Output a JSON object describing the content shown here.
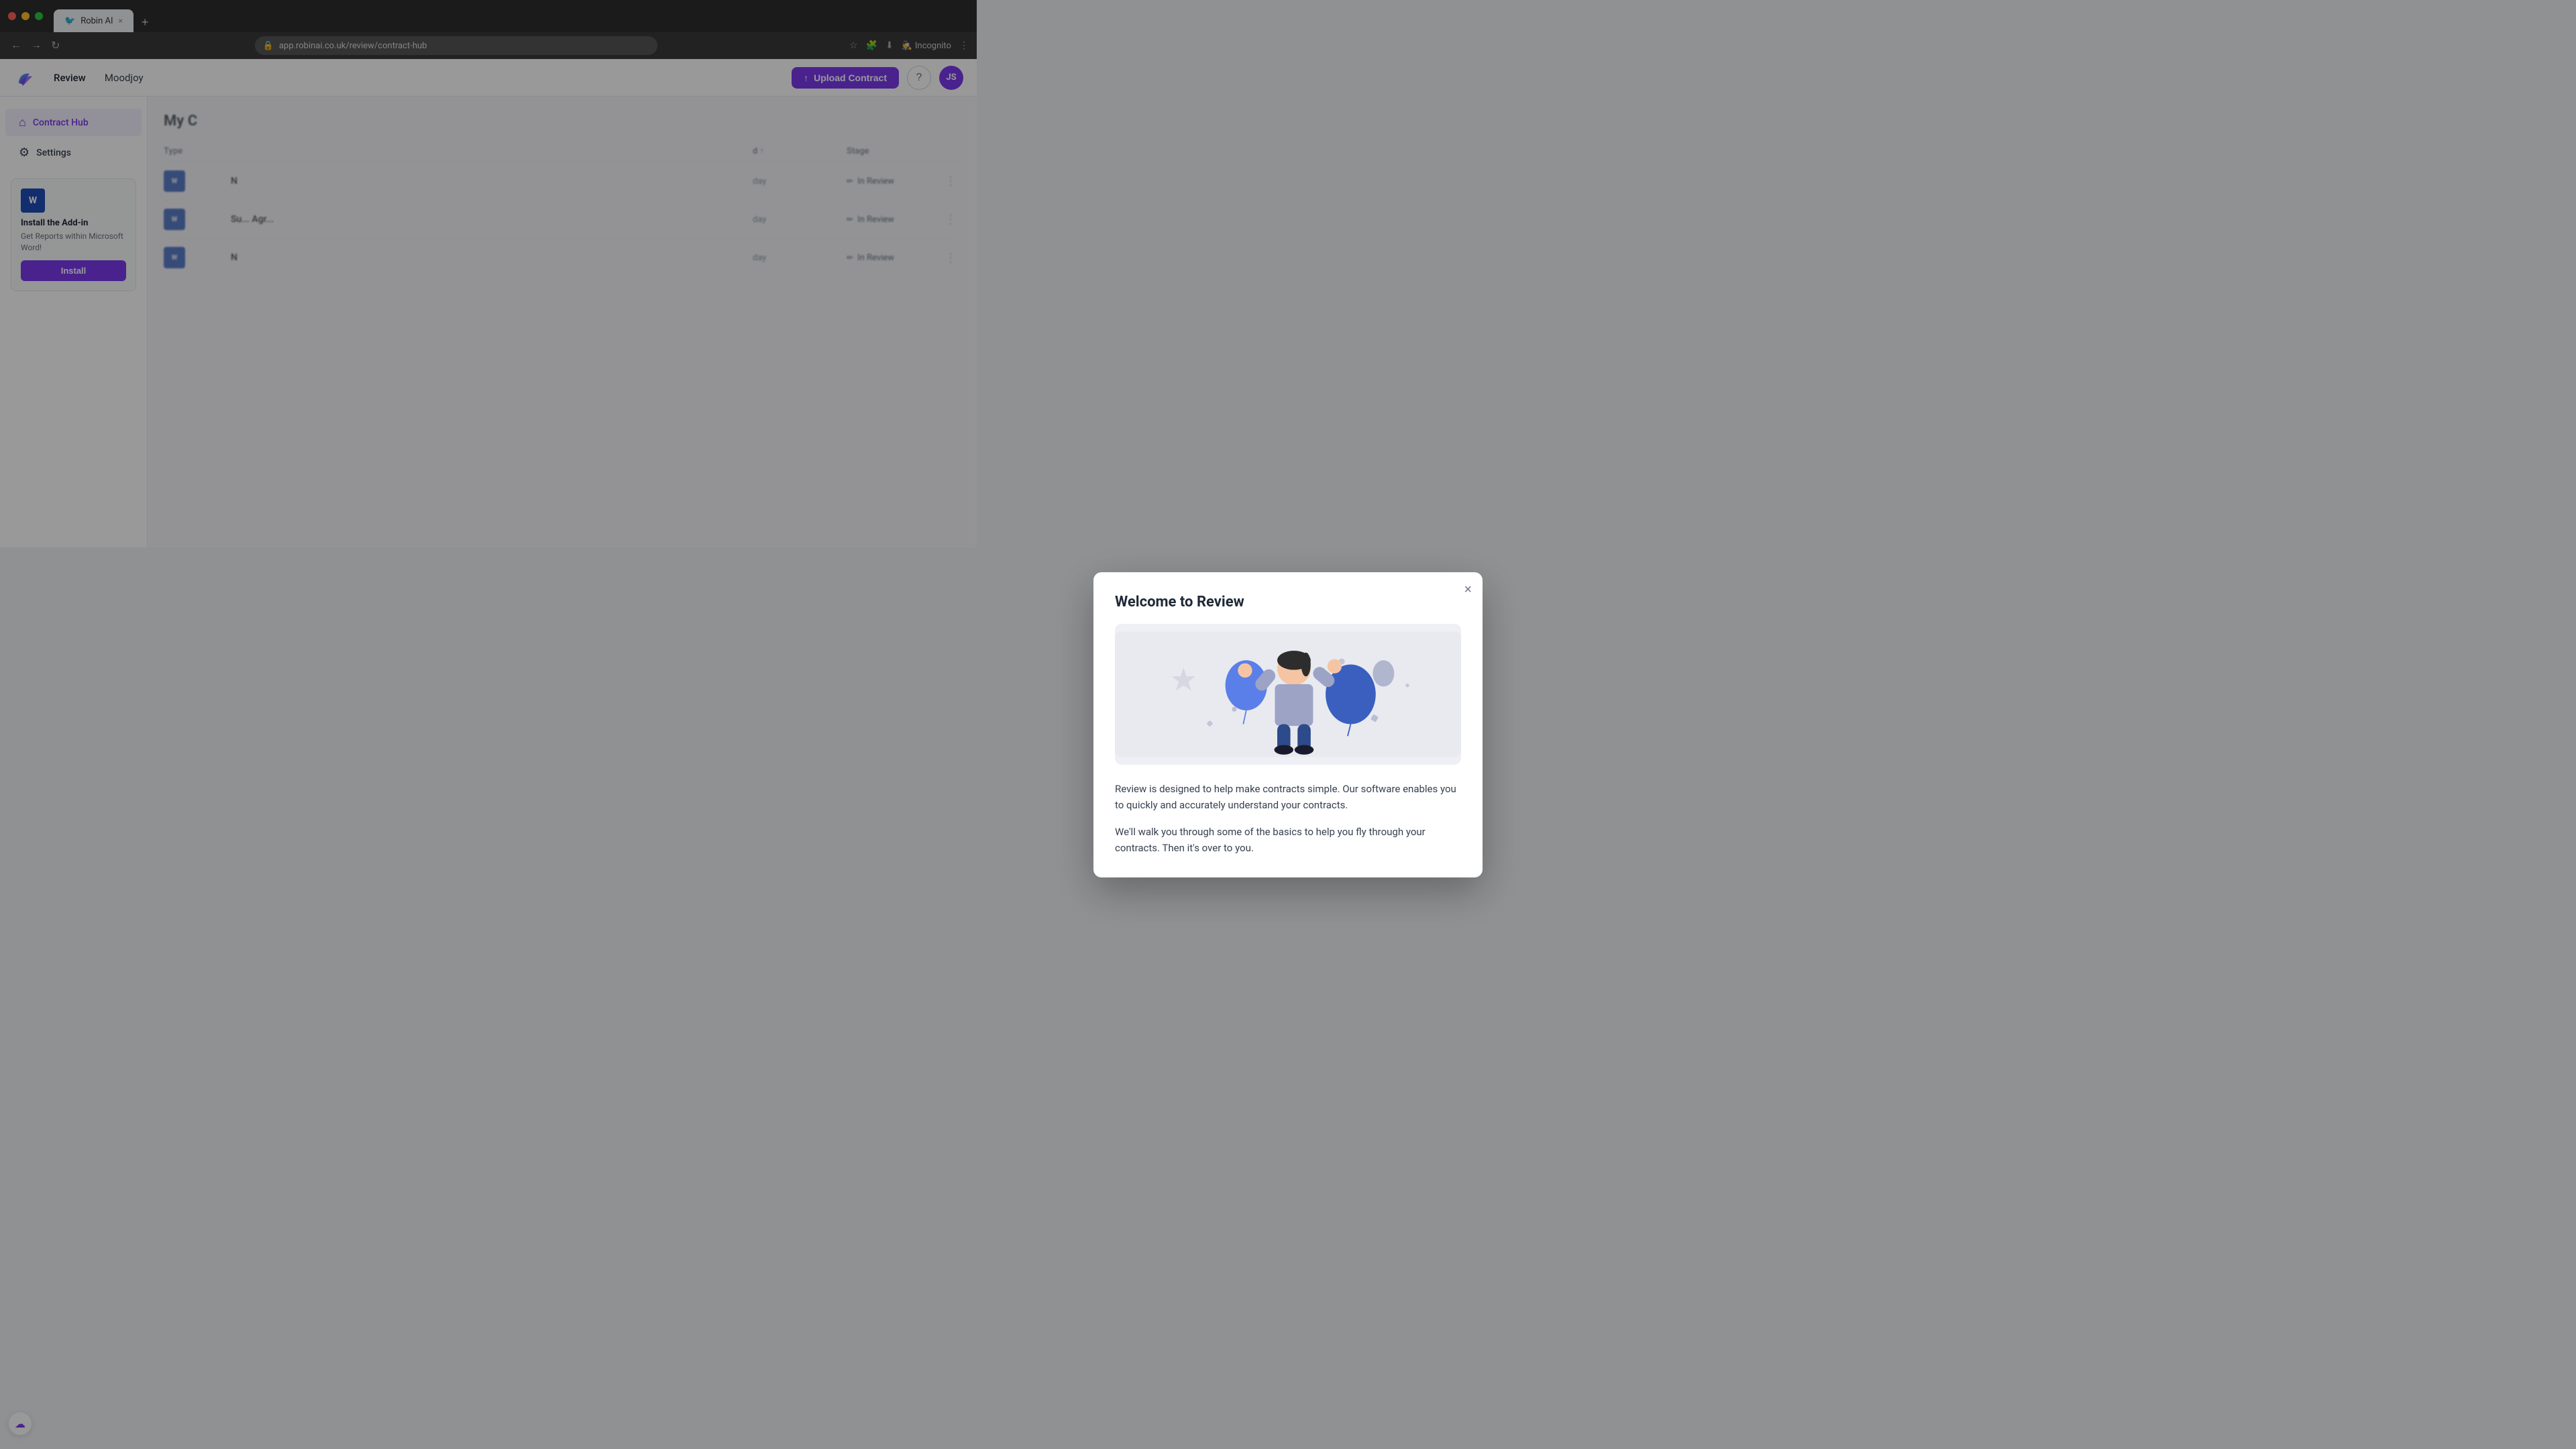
{
  "browser": {
    "tab_icon": "🐦",
    "tab_title": "Robin AI",
    "tab_close": "×",
    "tab_new": "+",
    "url": "app.robinai.co.uk/review/contract-hub",
    "incognito_label": "Incognito",
    "nav_back": "←",
    "nav_forward": "→",
    "nav_reload": "↻"
  },
  "header": {
    "nav_review": "Review",
    "company_name": "Moodjoy",
    "upload_contract_label": "Upload Contract",
    "upload_icon": "↑",
    "help_icon": "?",
    "avatar_initials": "JS"
  },
  "sidebar": {
    "items": [
      {
        "id": "contract-hub",
        "label": "Contract Hub",
        "icon": "⌂",
        "active": true
      },
      {
        "id": "settings",
        "label": "Settings",
        "icon": "⚙",
        "active": false
      }
    ],
    "addon": {
      "title": "Install the Add-in",
      "description": "Get Reports within Microsoft Word!",
      "install_label": "Install"
    }
  },
  "content": {
    "page_title": "My C",
    "table_columns": [
      "Type",
      "",
      "d ↑",
      "Stage"
    ],
    "rows": [
      {
        "type": "W",
        "name": "N",
        "date": "day",
        "stage": "In Review"
      },
      {
        "type": "W",
        "name": "Su... Agr...",
        "date": "day",
        "stage": "In Review"
      },
      {
        "type": "W",
        "name": "N",
        "date": "day",
        "stage": "In Review"
      }
    ]
  },
  "modal": {
    "title": "Welcome to Review",
    "close_label": "×",
    "desc1": "Review is designed to help make contracts simple. Our software enables you to quickly and accurately understand your contracts.",
    "desc2": "We'll walk you through some of the basics to help you fly through your contracts. Then it's over to you."
  },
  "floating": {
    "icon": "☁"
  },
  "colors": {
    "accent": "#7c3aed",
    "brand_blue": "#1e4db7",
    "text_primary": "#1f2937",
    "text_secondary": "#6b7280",
    "border": "#e5e7eb",
    "bg_light": "#f8f9fb"
  }
}
